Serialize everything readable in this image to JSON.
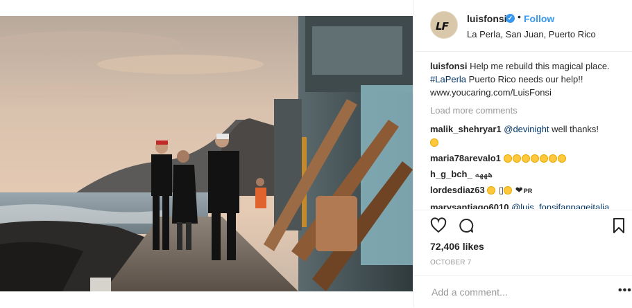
{
  "post": {
    "photo_alt": "",
    "header": {
      "username": "luisfonsi",
      "verified_glyph": "✓",
      "separator": "•",
      "follow_label": "Follow",
      "location": "La Perla, San Juan, Puerto Rico",
      "avatar_text": "LF"
    },
    "caption": {
      "username": "luisfonsi",
      "text": "Help me rebuild this magical place.",
      "hashtag": "#LaPerla",
      "text_2": "Puerto Rico needs our help!! www.youcaring.com/LuisFonsi"
    },
    "load_more_label": "Load more comments",
    "comments": [
      {
        "username": "malik_shehryar1",
        "mention": "@devinight",
        "text": "well thanks!",
        "emoji_count": 1
      },
      {
        "username": "maria78arevalo1",
        "text": "",
        "emoji_count": 7
      },
      {
        "username": "h_g_bch_",
        "text": "هههه",
        "emoji_count": 0
      },
      {
        "username": "lordesdiaz63",
        "text": "",
        "emoji_count": 2,
        "extra": "▯",
        "heart": "❤",
        "tail": "PR"
      },
      {
        "username": "marysantiago6010",
        "mention": "@luis_fonsifanpageitalia",
        "text": ""
      }
    ],
    "icons": {
      "like": "heart-outline-icon",
      "comment": "comment-bubble-icon",
      "save": "bookmark-icon"
    },
    "likes": "72,406 likes",
    "date": "OCTOBER 7",
    "add_comment_placeholder": "Add a comment...",
    "more_options": "•••",
    "colors": {
      "accent": "#3897f0",
      "muted": "#999999",
      "text": "#262626",
      "border": "#efefef"
    }
  }
}
